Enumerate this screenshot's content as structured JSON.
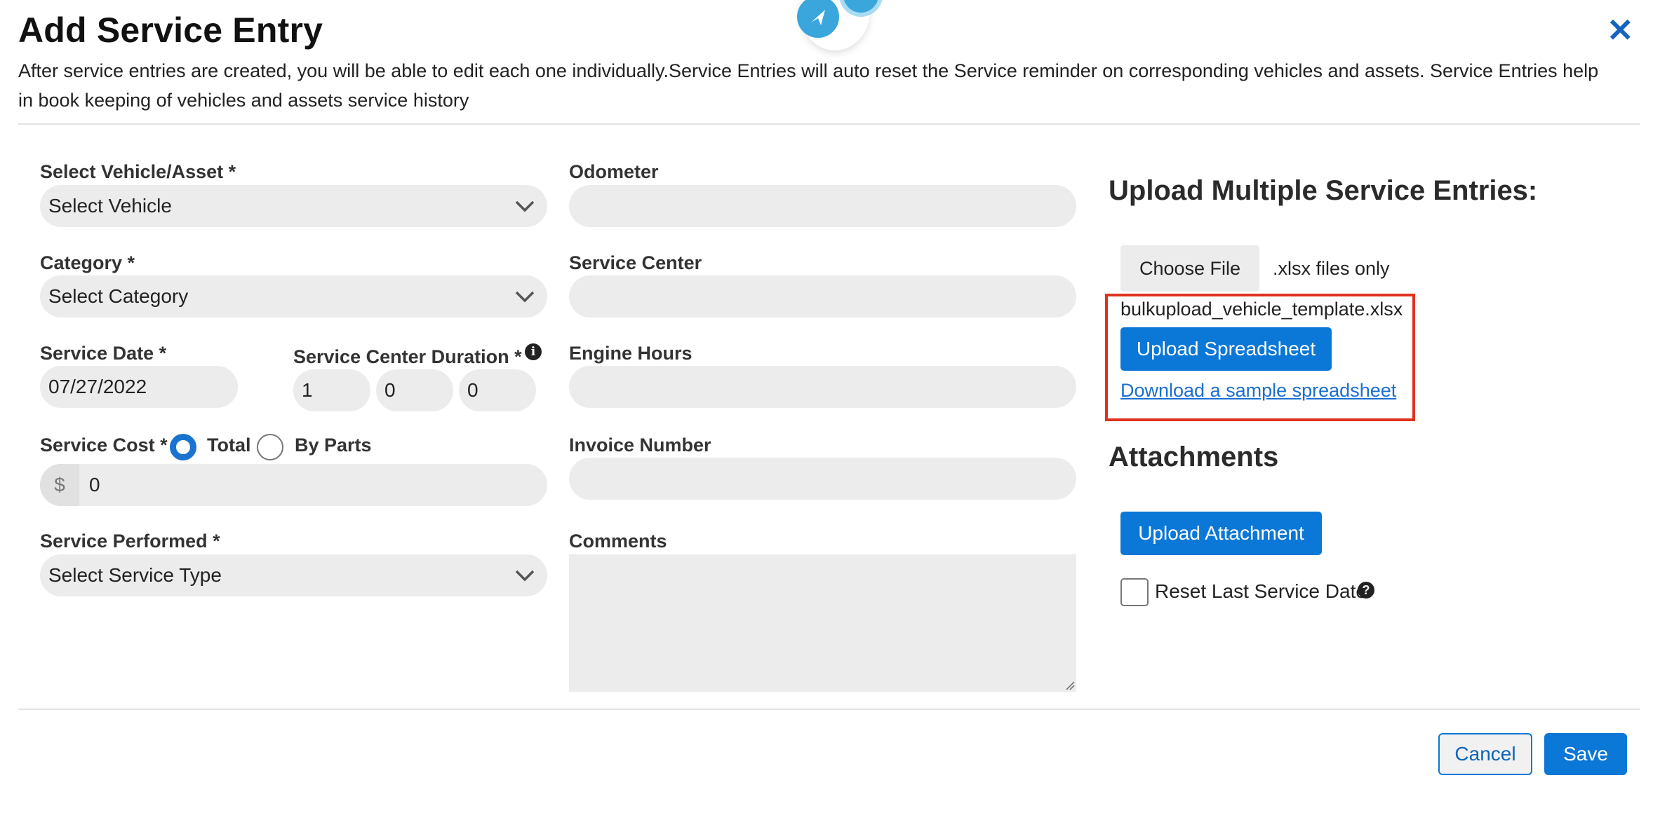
{
  "header": {
    "title": "Add Service Entry",
    "description": "After service entries are created, you will be able to edit each one individually.Service Entries will auto reset the Service reminder on corresponding vehicles and assets. Service Entries help in book keeping of vehicles and assets service history"
  },
  "form": {
    "vehicle": {
      "label": "Select Vehicle/Asset *",
      "value": "Select Vehicle"
    },
    "category": {
      "label": "Category *",
      "value": "Select Category"
    },
    "service_date": {
      "label": "Service Date *",
      "value": "07/27/2022"
    },
    "duration": {
      "label": "Service Center Duration *",
      "values": [
        "1",
        "0",
        "0"
      ]
    },
    "cost": {
      "label": "Service Cost *",
      "option_total": "Total",
      "option_parts": "By Parts",
      "selected": "Total",
      "currency": "$",
      "value": "0"
    },
    "service_performed": {
      "label": "Service Performed *",
      "value": "Select Service Type"
    },
    "odometer": {
      "label": "Odometer",
      "value": ""
    },
    "service_center": {
      "label": "Service Center",
      "value": ""
    },
    "engine_hours": {
      "label": "Engine Hours",
      "value": ""
    },
    "invoice_number": {
      "label": "Invoice Number",
      "value": ""
    },
    "comments": {
      "label": "Comments",
      "value": ""
    }
  },
  "upload": {
    "heading": "Upload Multiple Service Entries:",
    "choose_file": "Choose File",
    "file_hint": ".xlsx files only",
    "file_name": "bulkupload_vehicle_template.xlsx",
    "upload_button": "Upload Spreadsheet",
    "sample_link": "Download a sample spreadsheet"
  },
  "attachments": {
    "heading": "Attachments",
    "upload_button": "Upload Attachment",
    "reset_label": "Reset Last Service Date",
    "reset_checked": false
  },
  "footer": {
    "cancel": "Cancel",
    "save": "Save"
  },
  "colors": {
    "accent": "#0b77d6",
    "highlight": "#e0321e",
    "close": "#1565c0"
  }
}
